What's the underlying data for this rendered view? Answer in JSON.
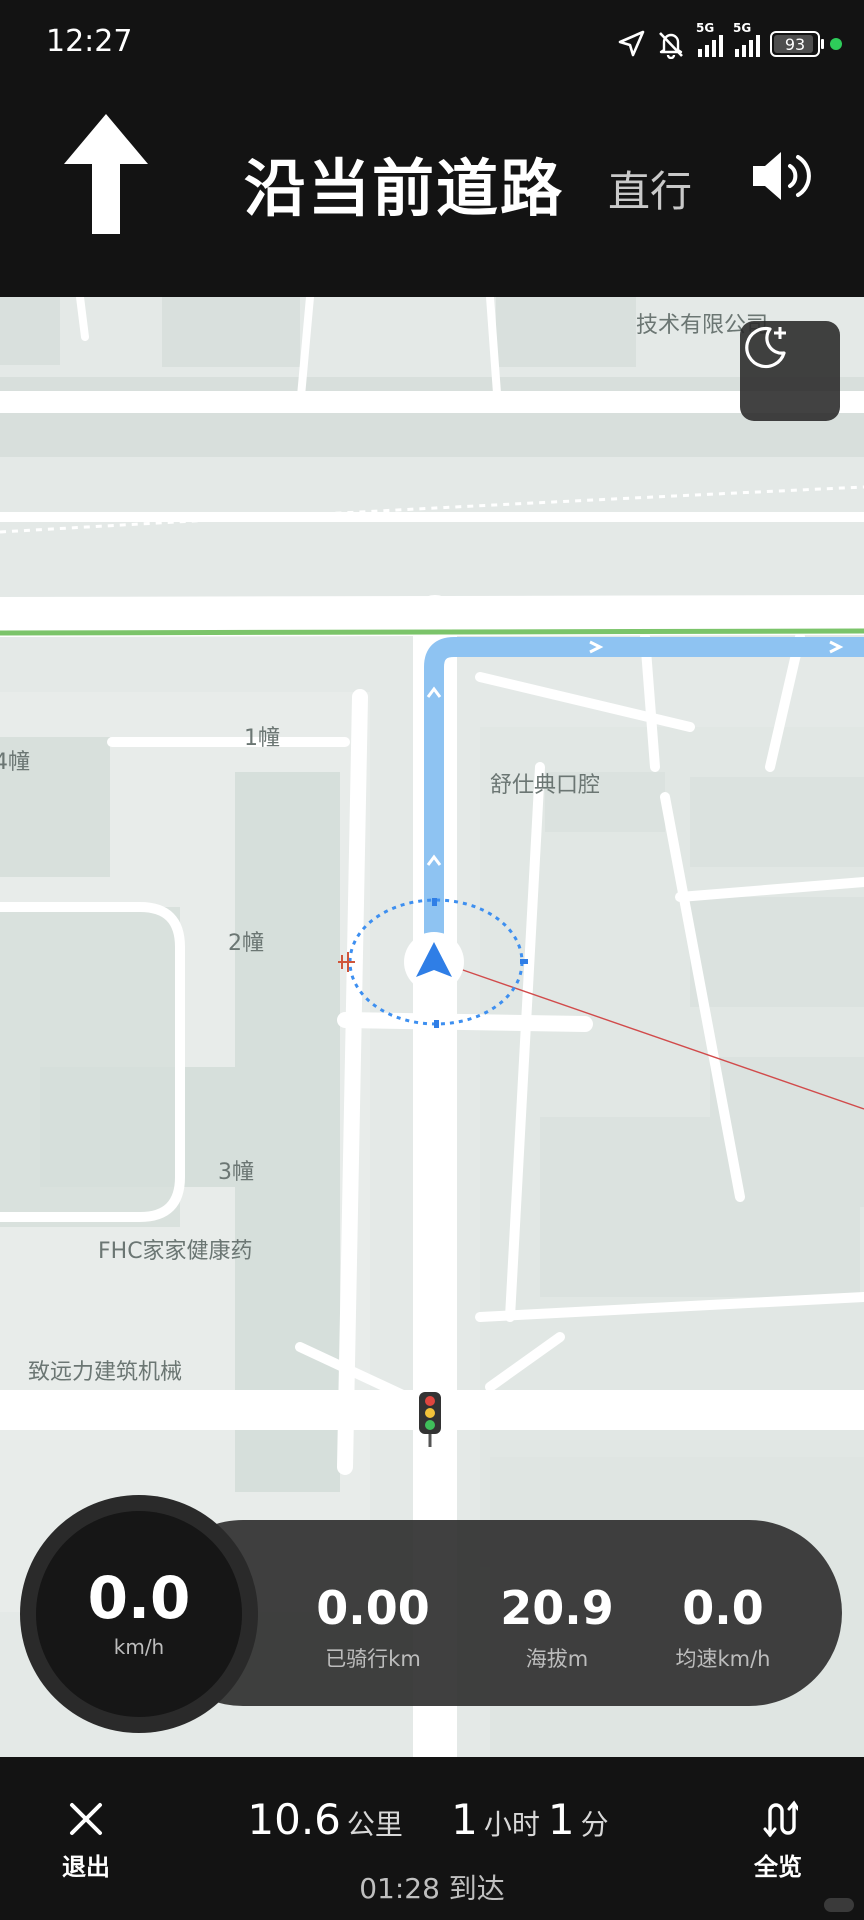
{
  "status_bar": {
    "time": "12:27",
    "net1": "5G",
    "net2": "5G",
    "battery": "93",
    "battery_level": 0.93,
    "icons": [
      "location-arrow-icon",
      "bell-muted-icon",
      "signal-icon",
      "signal-icon",
      "battery-icon",
      "active-dot-icon"
    ]
  },
  "nav": {
    "direction_icon": "arrow-up-icon",
    "instruction": "沿当前道路",
    "action": "直行",
    "voice_icon": "speaker-icon"
  },
  "map": {
    "night_mode_icon": "moon-plus-icon",
    "labels": [
      "技术有限公司",
      "1幢",
      "4幢",
      "舒仕典口腔",
      "2幢",
      "3幢",
      "FHC家家健康药",
      "致远力建筑机械"
    ],
    "colors": {
      "route": "#8ec3f2",
      "arrow": "#2f7ee6",
      "green_road": "#7bc46a"
    }
  },
  "dashboard": {
    "speed": "0.0",
    "speed_unit": "km/h",
    "stats": [
      {
        "value": "0.00",
        "label": "已骑行km"
      },
      {
        "value": "20.9",
        "label": "海拔m"
      },
      {
        "value": "0.0",
        "label": "均速km/h"
      }
    ]
  },
  "bottom_bar": {
    "exit_label": "退出",
    "distance": "10.6",
    "distance_unit": "公里",
    "hours": "1",
    "hours_unit": "小时",
    "minutes": "1",
    "minutes_unit": "分",
    "arrival_time": "01:28",
    "arrival_suffix": "到达",
    "overview_label": "全览"
  }
}
